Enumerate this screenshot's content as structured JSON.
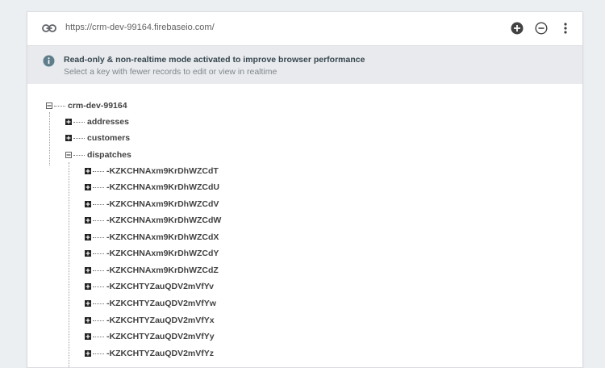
{
  "url_bar": {
    "url": "https://crm-dev-99164.firebaseio.com/",
    "icons": [
      "link-icon",
      "add-icon",
      "remove-icon",
      "more-vert-icon"
    ]
  },
  "banner": {
    "title": "Read-only & non-realtime mode activated to improve browser performance",
    "subtitle": "Select a key with fewer records to edit or view in realtime",
    "icon": "info-icon"
  },
  "tree": {
    "root": "crm-dev-99164",
    "children": [
      {
        "label": "addresses",
        "state": "collapsed"
      },
      {
        "label": "customers",
        "state": "collapsed"
      },
      {
        "label": "dispatches",
        "state": "expanded"
      }
    ],
    "dispatch_keys": [
      "-KZKCHNAxm9KrDhWZCdT",
      "-KZKCHNAxm9KrDhWZCdU",
      "-KZKCHNAxm9KrDhWZCdV",
      "-KZKCHNAxm9KrDhWZCdW",
      "-KZKCHNAxm9KrDhWZCdX",
      "-KZKCHNAxm9KrDhWZCdY",
      "-KZKCHNAxm9KrDhWZCdZ",
      "-KZKCHTYZauQDV2mVfYv",
      "-KZKCHTYZauQDV2mVfYw",
      "-KZKCHTYZauQDV2mVfYx",
      "-KZKCHTYZauQDV2mVfYy",
      "-KZKCHTYZauQDV2mVfYz"
    ]
  },
  "colors": {
    "page_bg": "#eceff1",
    "banner_bg": "#e8eaed",
    "text_dark": "#424242",
    "icon_dark": "#212121"
  }
}
